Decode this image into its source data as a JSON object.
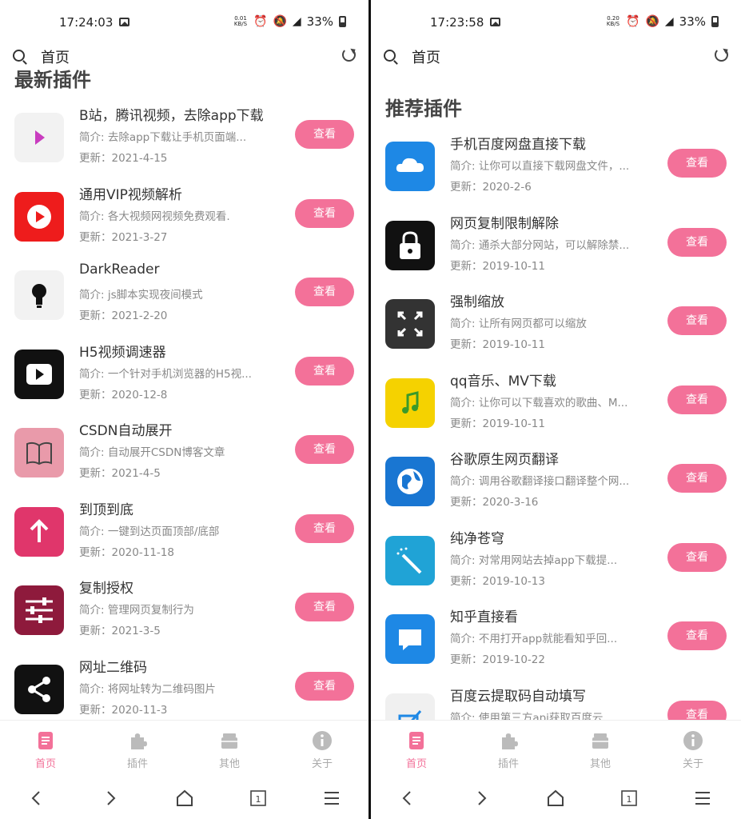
{
  "left": {
    "status": {
      "time": "17:24:03",
      "speed": "0.01\nKB/S",
      "battery": "33%",
      "net": "4G"
    },
    "search": {
      "label": "首页"
    },
    "section_title": "最新插件",
    "items": [
      {
        "name": "B站，腾讯视频，去除app下载",
        "desc": "简介: 去除app下载让手机页面端...",
        "date": "更新：2021-4-15",
        "button": "查看",
        "icon": "play-triangle-icon"
      },
      {
        "name": "通用VIP视频解析",
        "desc": "简介: 各大视频网视频免费观看.",
        "date": "更新：2021-3-27",
        "button": "查看",
        "icon": "youtube-play-icon"
      },
      {
        "name": "DarkReader",
        "desc": "简介: js脚本实现夜间模式",
        "date": "更新：2021-2-20",
        "button": "查看",
        "icon": "lightbulb-icon"
      },
      {
        "name": "H5视频调速器",
        "desc": "简介: 一个针对手机浏览器的H5视...",
        "date": "更新：2020-12-8",
        "button": "查看",
        "icon": "video-play-icon"
      },
      {
        "name": "CSDN自动展开",
        "desc": "简介: 自动展开CSDN博客文章",
        "date": "更新：2021-4-5",
        "button": "查看",
        "icon": "book-icon"
      },
      {
        "name": "到顶到底",
        "desc": "简介: 一键到达页面顶部/底部",
        "date": "更新：2020-11-18",
        "button": "查看",
        "icon": "arrow-up-icon"
      },
      {
        "name": "复制授权",
        "desc": "简介: 管理网页复制行为",
        "date": "更新：2021-3-5",
        "button": "查看",
        "icon": "sliders-icon"
      },
      {
        "name": "网址二维码",
        "desc": "简介: 将网址转为二维码图片",
        "date": "更新：2020-11-3",
        "button": "查看",
        "icon": "share-icon"
      }
    ],
    "tabs": [
      {
        "label": "首页",
        "icon": "document-icon",
        "active": true
      },
      {
        "label": "插件",
        "icon": "puzzle-icon",
        "active": false
      },
      {
        "label": "其他",
        "icon": "box-icon",
        "active": false
      },
      {
        "label": "关于",
        "icon": "info-icon",
        "active": false
      }
    ],
    "tabs_page_count": "1"
  },
  "right": {
    "status": {
      "time": "17:23:58",
      "speed": "0.20\nKB/S",
      "battery": "33%",
      "net": "4G"
    },
    "search": {
      "label": "首页"
    },
    "section_title": "推荐插件",
    "items": [
      {
        "name": "手机百度网盘直接下载",
        "desc": "简介: 让你可以直接下载网盘文件，...",
        "date": "更新：2020-2-6",
        "button": "查看",
        "icon": "cloud-icon"
      },
      {
        "name": "网页复制限制解除",
        "desc": "简介: 通杀大部分网站，可以解除禁...",
        "date": "更新：2019-10-11",
        "button": "查看",
        "icon": "unlock-icon"
      },
      {
        "name": "强制缩放",
        "desc": "简介: 让所有网页都可以缩放",
        "date": "更新：2019-10-11",
        "button": "查看",
        "icon": "expand-icon"
      },
      {
        "name": "qq音乐、MV下载",
        "desc": "简介: 让你可以下载喜欢的歌曲、M...",
        "date": "更新：2019-10-11",
        "button": "查看",
        "icon": "music-note-icon"
      },
      {
        "name": "谷歌原生网页翻译",
        "desc": "简介: 调用谷歌翻译接口翻译整个网...",
        "date": "更新：2020-3-16",
        "button": "查看",
        "icon": "globe-icon"
      },
      {
        "name": "纯净苍穹",
        "desc": "简介: 对常用网站去掉app下载提...",
        "date": "更新：2019-10-13",
        "button": "查看",
        "icon": "magic-wand-icon"
      },
      {
        "name": "知乎直接看",
        "desc": "简介: 不用打开app就能看知乎回...",
        "date": "更新：2019-10-22",
        "button": "查看",
        "icon": "chat-bubble-icon"
      },
      {
        "name": "百度云提取码自动填写",
        "desc": "简介: 使用第三方api获取百度云...",
        "date": "",
        "button": "查看",
        "icon": "edit-icon"
      }
    ],
    "tabs": [
      {
        "label": "首页",
        "icon": "document-icon",
        "active": true
      },
      {
        "label": "插件",
        "icon": "puzzle-icon",
        "active": false
      },
      {
        "label": "其他",
        "icon": "box-icon",
        "active": false
      },
      {
        "label": "关于",
        "icon": "info-icon",
        "active": false
      }
    ],
    "tabs_page_count": "1"
  },
  "colors": {
    "accent": "#f37199",
    "title": "#444444",
    "muted": "#888888"
  }
}
